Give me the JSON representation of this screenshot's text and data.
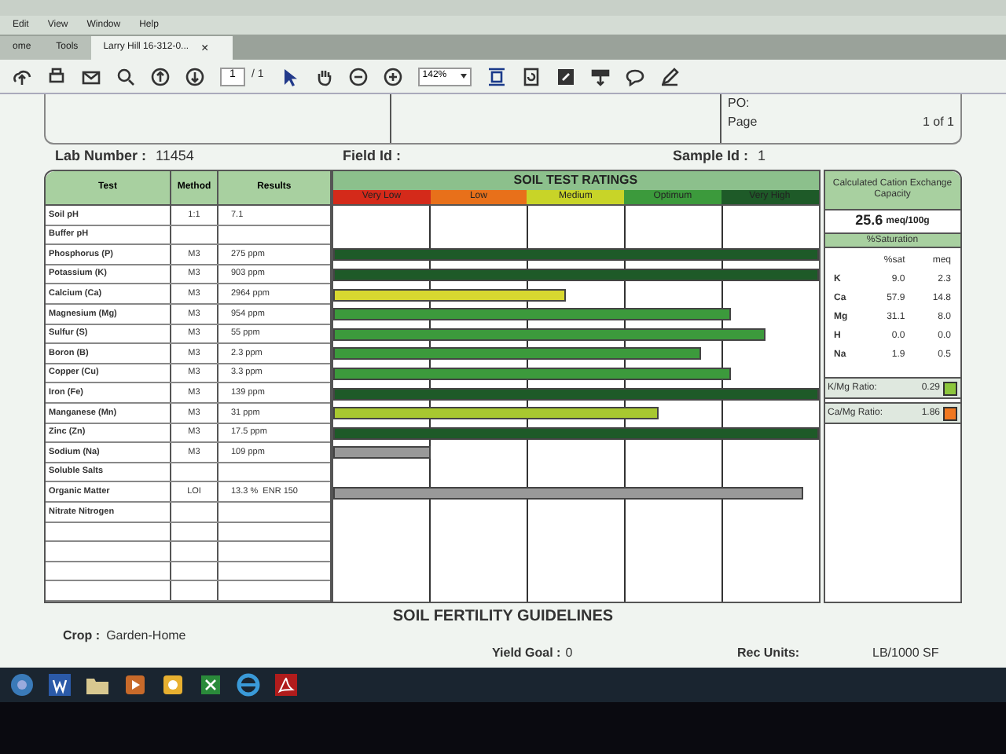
{
  "menu": [
    "Edit",
    "View",
    "Window",
    "Help"
  ],
  "tabs": [
    {
      "label": "ome",
      "selected": false
    },
    {
      "label": "Tools",
      "selected": false
    },
    {
      "label": "Larry Hill 16-312-0...",
      "selected": true
    }
  ],
  "tab_close": "×",
  "toolbar": {
    "page": "1",
    "page_count": "/ 1",
    "zoom": "142%"
  },
  "header": {
    "po_label": "PO:",
    "page_label": "Page",
    "page_value": "1 of 1"
  },
  "lab_line": [
    {
      "label": "Lab Number :",
      "value": "11454"
    },
    {
      "label": "Field Id :"
    },
    {
      "label": "Sample Id :",
      "value": "1"
    }
  ],
  "table": {
    "columns": [
      "Test",
      "Method",
      "Results"
    ],
    "rows": [
      {
        "test": "Soil pH",
        "method": "1:1",
        "result": "7.1"
      },
      {
        "test": "Buffer pH",
        "method": "",
        "result": ""
      },
      {
        "test": "Phosphorus (P)",
        "method": "M3",
        "result": "275 ppm",
        "level": 1.0,
        "color": "#1e5a28"
      },
      {
        "test": "Potassium (K)",
        "method": "M3",
        "result": "903 ppm",
        "level": 1.0,
        "color": "#1e5a28"
      },
      {
        "test": "Calcium (Ca)",
        "method": "M3",
        "result": "2964 ppm",
        "level": 0.48,
        "color": "#d8d830"
      },
      {
        "test": "Magnesium (Mg)",
        "method": "M3",
        "result": "954 ppm",
        "level": 0.82,
        "color": "#3c9a3c"
      },
      {
        "test": "Sulfur (S)",
        "method": "M3",
        "result": "55 ppm",
        "level": 0.89,
        "color": "#3c9a3c"
      },
      {
        "test": "Boron (B)",
        "method": "M3",
        "result": "2.3 ppm",
        "level": 0.76,
        "color": "#3c9a3c"
      },
      {
        "test": "Copper (Cu)",
        "method": "M3",
        "result": "3.3 ppm",
        "level": 0.82,
        "color": "#3c9a3c"
      },
      {
        "test": "Iron (Fe)",
        "method": "M3",
        "result": "139 ppm",
        "level": 1.0,
        "color": "#1e5a28"
      },
      {
        "test": "Manganese (Mn)",
        "method": "M3",
        "result": "31 ppm",
        "level": 0.67,
        "color": "#a8c830"
      },
      {
        "test": "Zinc (Zn)",
        "method": "M3",
        "result": "17.5 ppm",
        "level": 1.0,
        "color": "#1e5a28"
      },
      {
        "test": "Sodium (Na)",
        "method": "M3",
        "result": "109 ppm",
        "level": 0.2,
        "color": "#999999"
      },
      {
        "test": "Soluble Salts",
        "method": "",
        "result": ""
      },
      {
        "test": "Organic Matter",
        "method": "LOI",
        "result": "13.3 %  ENR 150",
        "level": 0.97,
        "color": "#999999"
      },
      {
        "test": "Nitrate Nitrogen",
        "method": "",
        "result": ""
      },
      {
        "test": "",
        "method": "",
        "result": ""
      },
      {
        "test": "",
        "method": "",
        "result": ""
      },
      {
        "test": "",
        "method": "",
        "result": ""
      },
      {
        "test": "",
        "method": "",
        "result": ""
      }
    ]
  },
  "ratings": {
    "title": "SOIL TEST RATINGS",
    "categories": [
      {
        "label": "Very Low",
        "color": "#d42a1a"
      },
      {
        "label": "Low",
        "color": "#e8701a"
      },
      {
        "label": "Medium",
        "color": "#c8d428"
      },
      {
        "label": "Optimum",
        "color": "#3c9a3c"
      },
      {
        "label": "Very High",
        "color": "#1e5a28"
      }
    ]
  },
  "cec": {
    "title": "Calculated Cation Exchange Capacity",
    "value": "25.6",
    "unit": "meq/100g",
    "saturation_title": "%Saturation",
    "columns": [
      "%sat",
      "meq"
    ],
    "rows": [
      {
        "ion": "K",
        "sat": "9.0",
        "meq": "2.3"
      },
      {
        "ion": "Ca",
        "sat": "57.9",
        "meq": "14.8"
      },
      {
        "ion": "Mg",
        "sat": "31.1",
        "meq": "8.0"
      },
      {
        "ion": "H",
        "sat": "0.0",
        "meq": "0.0"
      },
      {
        "ion": "Na",
        "sat": "1.9",
        "meq": "0.5"
      }
    ],
    "ratios": [
      {
        "label": "K/Mg Ratio:",
        "value": "0.29",
        "color": "#8cc63c"
      },
      {
        "label": "Ca/Mg Ratio:",
        "value": "1.86",
        "color": "#f07820"
      }
    ]
  },
  "guidelines": {
    "title": "SOIL FERTILITY GUIDELINES",
    "crop_label": "Crop :",
    "crop": "Garden-Home",
    "yield_label": "Yield Goal :",
    "yield": "0",
    "units_label": "Rec Units:",
    "units": "LB/1000 SF"
  }
}
